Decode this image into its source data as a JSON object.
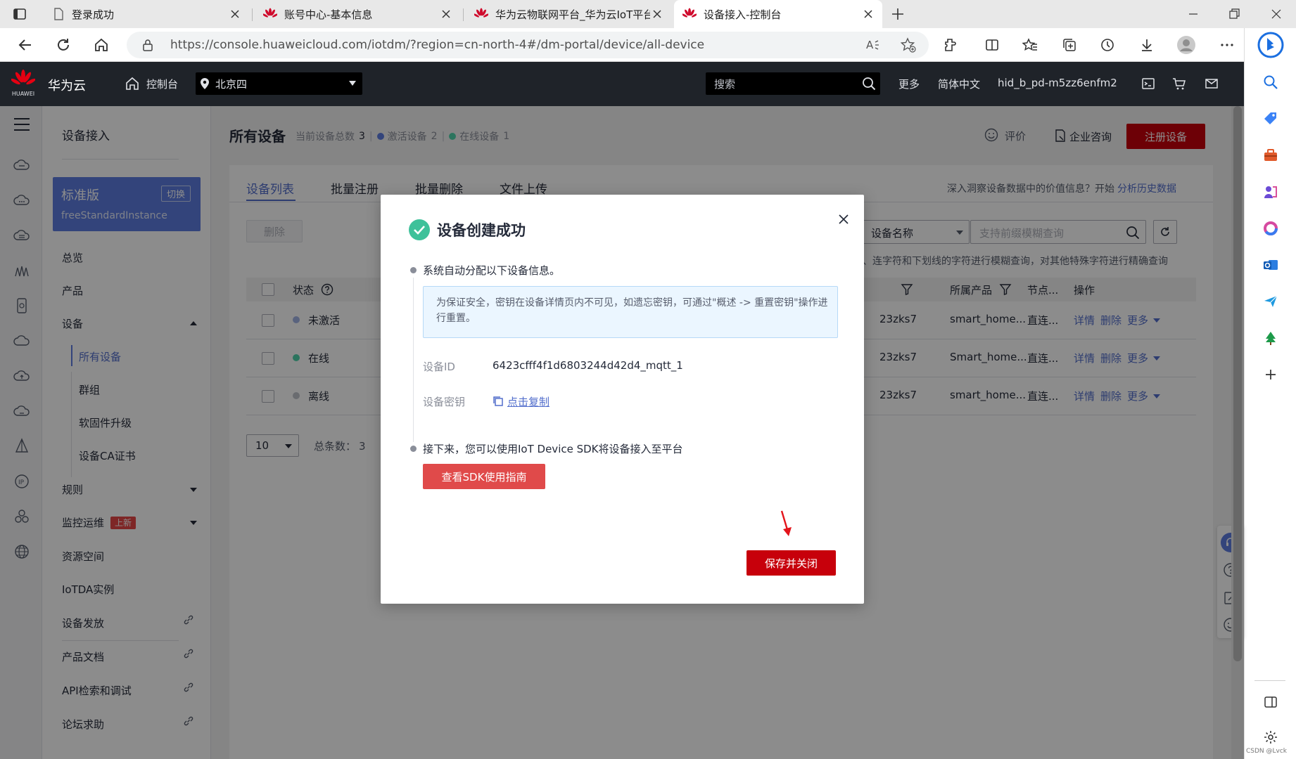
{
  "browser": {
    "tabs": [
      {
        "title": "登录成功",
        "active": false
      },
      {
        "title": "账号中心-基本信息",
        "active": false
      },
      {
        "title": "华为云物联网平台_华为云IoT平台",
        "active": false
      },
      {
        "title": "设备接入-控制台",
        "active": true
      }
    ],
    "url": "https://console.huaweicloud.com/iotdm/?region=cn-north-4#/dm-portal/device/all-device"
  },
  "header": {
    "logo_text": "华为云",
    "logo_sub": "HUAWEI",
    "console_label": "控制台",
    "region": "北京四",
    "search_placeholder": "搜索",
    "more": "更多",
    "language": "简体中文",
    "username": "hid_b_pd-m5zz6enfm2"
  },
  "menu": {
    "title": "设备接入",
    "instance": {
      "edition": "标准版",
      "switch_label": "切换",
      "name": "freeStandardInstance"
    },
    "items": {
      "overview": "总览",
      "product": "产品",
      "device": "设备",
      "all_devices": "所有设备",
      "group": "群组",
      "firmware": "软固件升级",
      "ca_cert": "设备CA证书",
      "rules": "规则",
      "monitoring": "监控运维",
      "monitoring_badge": "上新",
      "resource_space": "资源空间",
      "iotda_instance": "IoTDA实例",
      "provisioning": "设备发放",
      "docs": "产品文档",
      "api_explorer": "API检索和调试",
      "forum": "论坛求助"
    }
  },
  "main": {
    "page_title": "所有设备",
    "stats": {
      "total_label": "当前设备总数",
      "total": "3",
      "active_label": "激活设备",
      "active": "2",
      "online_label": "在线设备",
      "online": "1"
    },
    "rate_label": "评价",
    "consult_label": "企业咨询",
    "register_button": "注册设备",
    "tabs": [
      "设备列表",
      "批量注册",
      "批量删除",
      "文件上传"
    ],
    "insight_text": "深入洞察设备数据中的价值信息？开始",
    "insight_link": "分析历史数据",
    "delete_button": "删除",
    "filter_select": "设备名称",
    "filter_placeholder": "支持前缀模糊查询",
    "filter_hint": "、连字符和下划线的字符进行模糊查询，对其他特殊字符进行精确查询",
    "columns": {
      "status": "状态",
      "product": "所属产品",
      "node": "节点...",
      "actions": "操作"
    },
    "rows": [
      {
        "status": "未激活",
        "status_color": "#a3b4e5",
        "id_tail": "23zks7",
        "product": "smart_home...",
        "node": "直连...",
        "detail": "详情",
        "delete": "删除",
        "more": "更多"
      },
      {
        "status": "在线",
        "status_color": "#50d4ab",
        "id_tail": "23zks7",
        "product": "Smart_home...",
        "node": "直连...",
        "detail": "详情",
        "delete": "删除",
        "more": "更多"
      },
      {
        "status": "离线",
        "status_color": "#c2c5cc",
        "id_tail": "23zks7",
        "product": "smart_home...",
        "node": "直连...",
        "detail": "详情",
        "delete": "删除",
        "more": "更多"
      }
    ],
    "page_size": "10",
    "total_label": "总条数：",
    "total_count": "3"
  },
  "modal": {
    "title": "设备创建成功",
    "step1": "系统自动分配以下设备信息。",
    "security_tip": "为保证安全，密钥在设备详情页内不可见，如遗忘密钥，可通过\"概述 -> 重置密钥\"操作进行重置。",
    "device_id_label": "设备ID",
    "device_id": "6423cfff4f1d6803244d42d4_mqtt_1",
    "secret_label": "设备密钥",
    "copy_link": "点击复制",
    "step2": "接下来，您可以使用IoT Device SDK将设备接入至平台",
    "sdk_button": "查看SDK使用指南",
    "save_button": "保存并关闭"
  },
  "watermark": "CSDN @Lvck",
  "colors": {
    "brand_red": "#c7000b",
    "link_blue": "#526ecc",
    "success_green": "#3ec19a",
    "header_dark": "#1f2329"
  }
}
